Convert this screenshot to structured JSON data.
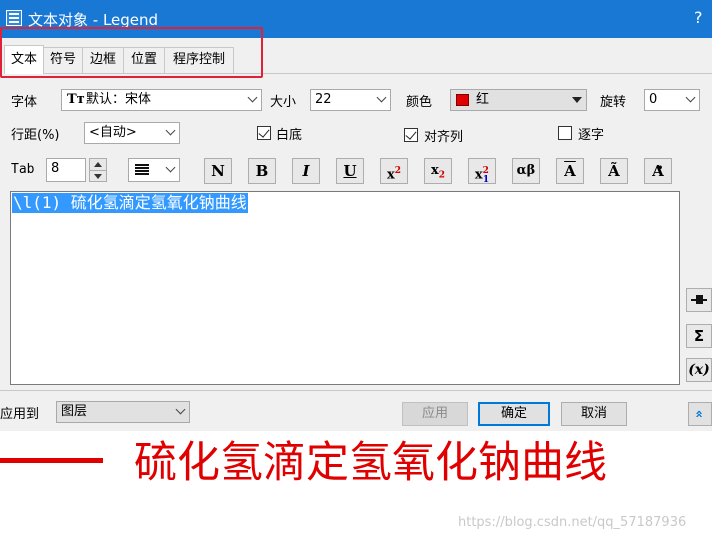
{
  "window": {
    "title": "文本对象 - Legend",
    "help": "?"
  },
  "tabs": [
    {
      "label": "文本",
      "active": true
    },
    {
      "label": "符号",
      "active": false
    },
    {
      "label": "边框",
      "active": false
    },
    {
      "label": "位置",
      "active": false
    },
    {
      "label": "程序控制",
      "active": false
    }
  ],
  "font": {
    "label": "字体",
    "value": "默认：宋体"
  },
  "size": {
    "label": "大小",
    "value": "22"
  },
  "color": {
    "label": "颜色",
    "value": "红",
    "swatch": "#e00000"
  },
  "rotate": {
    "label": "旋转",
    "value": "0"
  },
  "line_spacing": {
    "label": "行距(%)",
    "value": "<自动>"
  },
  "checkboxes": {
    "underlay": {
      "label": "白底",
      "checked": true
    },
    "align_columns": {
      "label": "对齐列",
      "checked": true
    },
    "per_char": {
      "label": "逐字",
      "checked": false
    }
  },
  "tab": {
    "label": "Tab",
    "value": "8"
  },
  "format_buttons": [
    {
      "name": "normal",
      "text": "N"
    },
    {
      "name": "bold",
      "text": "B"
    },
    {
      "name": "italic",
      "text": "I"
    },
    {
      "name": "underline",
      "text": "U"
    },
    {
      "name": "superscript",
      "text": "x"
    },
    {
      "name": "subscript",
      "text": "x"
    },
    {
      "name": "supsub",
      "text": "x"
    },
    {
      "name": "greek",
      "text": "αβ"
    },
    {
      "name": "overline",
      "text": "A"
    },
    {
      "name": "tilde",
      "text": "Ã"
    },
    {
      "name": "dot",
      "text": "A"
    }
  ],
  "editor": {
    "text": "\\l(1) 硫化氢滴定氢氧化钠曲线"
  },
  "side_buttons": {
    "sigma": "Σ",
    "variable": "(x)"
  },
  "apply_to": {
    "label": "应用到",
    "value": "图层"
  },
  "buttons": {
    "apply": "应用",
    "ok": "确定",
    "cancel": "取消",
    "collapse": "»"
  },
  "preview": {
    "text": "硫化氢滴定氢氧化钠曲线",
    "watermark": "https://blog.csdn.net/qq_57187936",
    "color": "#e00000"
  },
  "colors": {
    "titlebar": "#1978d4",
    "highlight": "#e0213a",
    "selection": "#3399ff"
  }
}
